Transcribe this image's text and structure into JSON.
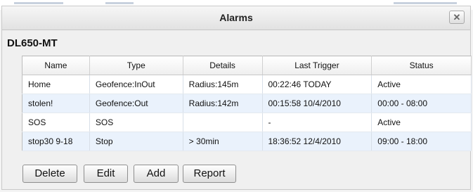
{
  "dialog": {
    "title": "Alarms",
    "close_label": "✕"
  },
  "device": {
    "name": "DL650-MT"
  },
  "table": {
    "headers": [
      "Name",
      "Type",
      "Details",
      "Last Trigger",
      "Status"
    ],
    "rows": [
      [
        "Home",
        "Geofence:InOut",
        "Radius:145m",
        "00:22:46 TODAY",
        "Active"
      ],
      [
        "stolen!",
        "Geofence:Out",
        "Radius:142m",
        "00:15:58 10/4/2010",
        "00:00 - 08:00"
      ],
      [
        "SOS",
        "SOS",
        "",
        "-",
        "Active"
      ],
      [
        "stop30 9-18",
        "Stop",
        "> 30min",
        "18:36:52 12/4/2010",
        "09:00 - 18:00"
      ]
    ]
  },
  "buttons": {
    "delete": "Delete",
    "edit": "Edit",
    "add": "Add",
    "report": "Report"
  }
}
